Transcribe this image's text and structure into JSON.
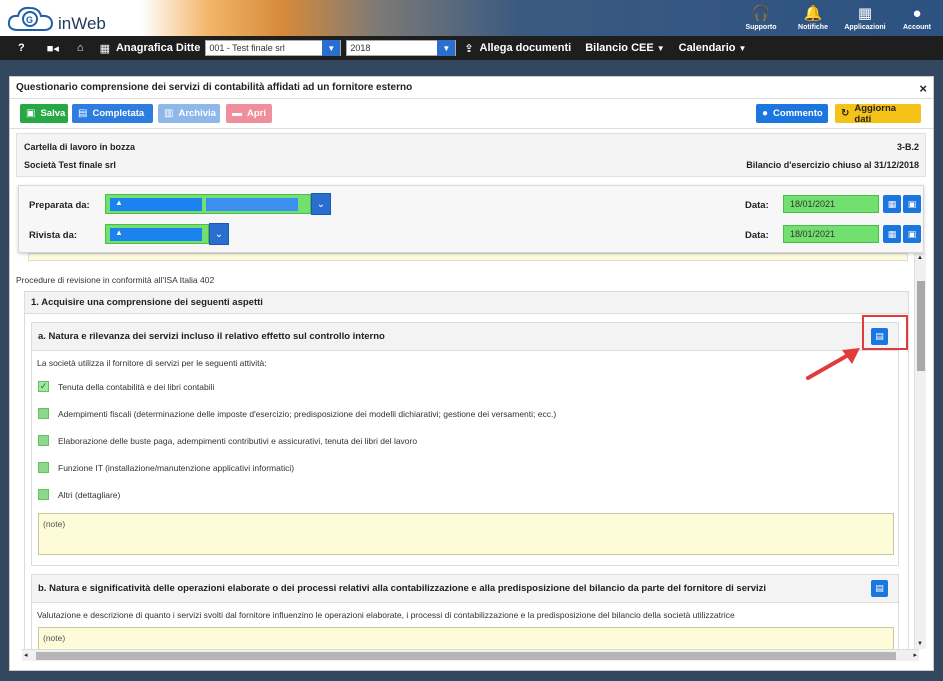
{
  "app": {
    "name": "inWeb"
  },
  "topbar": [
    {
      "icon": "headset-icon",
      "glyph": "🎧",
      "label": "Supporto"
    },
    {
      "icon": "bell-icon",
      "glyph": "🔔",
      "label": "Notifiche"
    },
    {
      "icon": "grid-icon",
      "glyph": "▦",
      "label": "Applicazioni"
    },
    {
      "icon": "user-icon",
      "glyph": "●",
      "label": "Account"
    }
  ],
  "navbar": {
    "help": "?",
    "anagrafica_label": "Anagrafica Ditte",
    "company_select": "001 - Test finale srl",
    "year_select": "2018",
    "allega_label": "Allega documenti",
    "bilancio_label": "Bilancio CEE",
    "calendario_label": "Calendario"
  },
  "modal": {
    "title": "Questionario comprensione dei servizi di contabilità affidati ad un fornitore esterno",
    "close": "×"
  },
  "toolbar": {
    "salva": "Salva",
    "completata": "Completata",
    "archivia": "Archivia",
    "apri": "Apri",
    "commento": "Commento",
    "aggiorna": "Aggiorna dati"
  },
  "info": {
    "status": "Cartella di lavoro in bozza",
    "code": "3-B.2",
    "company": "Società Test finale srl",
    "period": "Bilancio d'esercizio chiuso al 31/12/2018"
  },
  "signoff": {
    "preparata_label": "Preparata da:",
    "rivista_label": "Rivista da:",
    "data_label": "Data:",
    "preparata_date": "18/01/2021",
    "rivista_date": "18/01/2021"
  },
  "content": {
    "procedure": "Procedure di revisione in conformità all'ISA Italia 402",
    "section1_title": "1. Acquisire una comprensione dei seguenti aspetti",
    "suba_title": "a. Natura e rilevanza dei servizi incluso il relativo effetto sul controllo interno",
    "suba_desc": "La società utilizza il fornitore di servizi per le seguenti attività:",
    "options": [
      {
        "label": "Tenuta della contabilità e dei libri contabili",
        "checked": true
      },
      {
        "label": "Adempimenti fiscali (determinazione delle imposte d'esercizio; predisposizione dei modelli dichiarativi; gestione dei versamenti; ecc.)",
        "checked": false
      },
      {
        "label": "Elaborazione delle buste paga, adempimenti contributivi e assicurativi, tenuta dei libri del lavoro",
        "checked": false
      },
      {
        "label": "Funzione IT (installazione/manutenzione applicativi informatici)",
        "checked": false
      },
      {
        "label": "Altri (dettagliare)",
        "checked": false
      }
    ],
    "note_placeholder": "(note)",
    "subb_title": "b. Natura e significatività delle operazioni elaborate o dei processi relativi alla contabilizzazione e alla predisposizione del bilancio da parte del fornitore di servizi",
    "subb_desc": "Valutazione e descrizione di quanto i servizi svolti dal fornitore influenzino le operazioni elaborate, i processi di contabilizzazione e la predisposizione del bilancio della società utilizzatrice",
    "note_b_placeholder": "(note)"
  },
  "colors": {
    "salva": "#28a745",
    "completata": "#2d7de0",
    "archivia": "#8fb8ea",
    "apri": "#ee8f9b",
    "commento": "#1b76df",
    "aggiorna": "#f5c218",
    "highlight": "#e03c3c"
  }
}
